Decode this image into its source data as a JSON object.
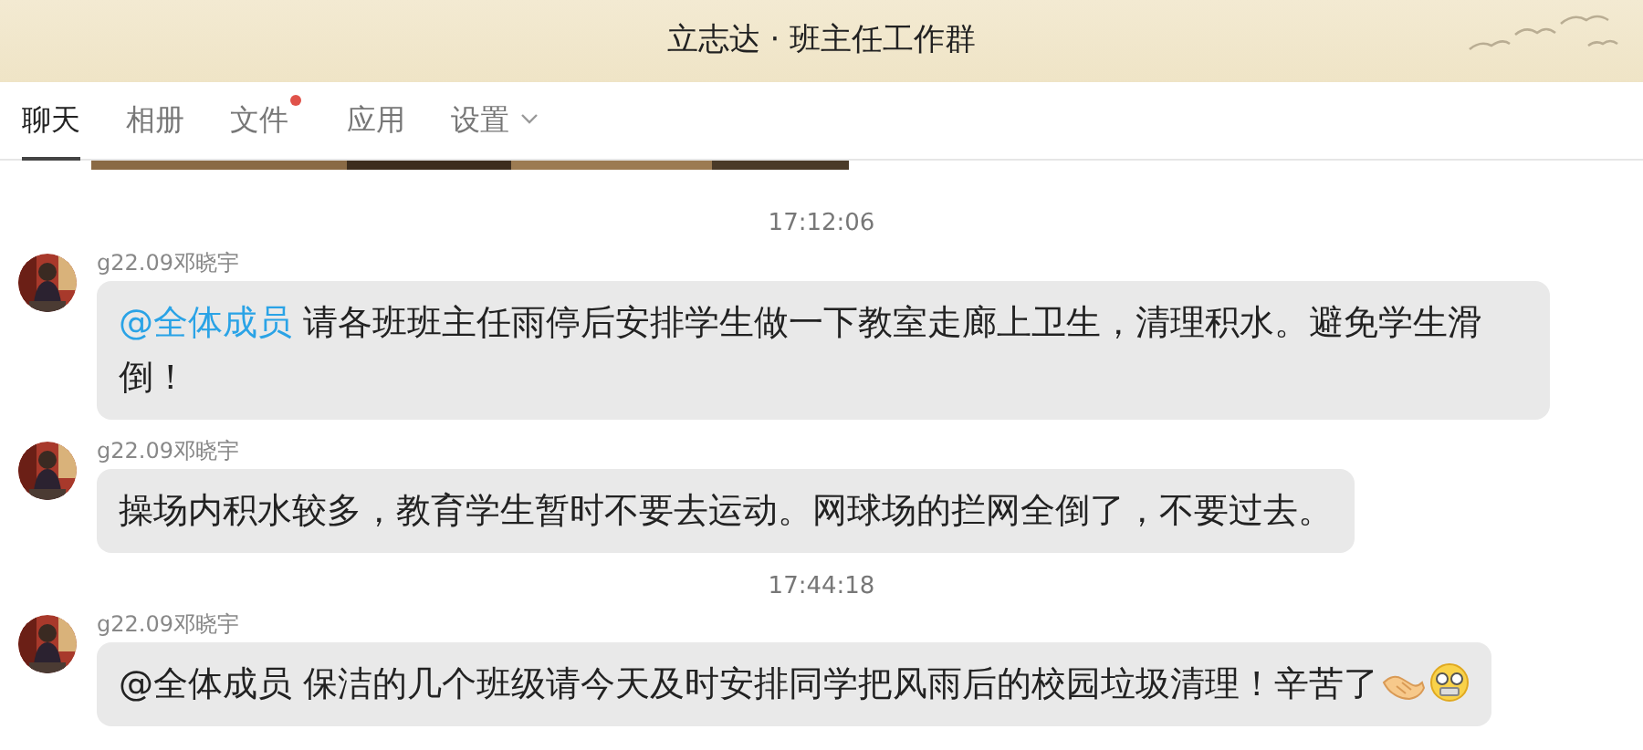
{
  "window": {
    "title": "立志达 · 班主任工作群"
  },
  "tabs": [
    {
      "label": "聊天",
      "selected": true,
      "unread": false,
      "dropdown": false
    },
    {
      "label": "相册",
      "selected": false,
      "unread": false,
      "dropdown": false
    },
    {
      "label": "文件",
      "selected": false,
      "unread": true,
      "dropdown": false
    },
    {
      "label": "应用",
      "selected": false,
      "unread": false,
      "dropdown": false
    },
    {
      "label": "设置",
      "selected": false,
      "unread": false,
      "dropdown": true
    }
  ],
  "chat": [
    {
      "kind": "picture"
    },
    {
      "kind": "time",
      "text": "17:12:06"
    },
    {
      "kind": "message",
      "sender": "g22.09邓晓宇",
      "avatar": {
        "kind": "picture"
      },
      "mention": "@全体成员",
      "text": "请各班班主任雨停后安排学生做一下教室走廊上卫生，清理积水。避免学生滑倒！"
    },
    {
      "kind": "message",
      "sender": "g22.09邓晓宇",
      "avatar": {
        "kind": "picture"
      },
      "text": "操场内积水较多，教育学生暂时不要去运动。网球场的拦网全倒了，不要过去。"
    },
    {
      "kind": "time",
      "text": "17:44:18"
    },
    {
      "kind": "message",
      "sender": "g22.09邓晓宇",
      "avatar": {
        "kind": "picture"
      },
      "text": "@全体成员 保洁的几个班级请今天及时安排同学把风雨后的校园垃圾清理！辛苦了",
      "emoji": [
        {
          "kind": "handshake"
        },
        {
          "kind": "shocked"
        }
      ]
    }
  ]
}
